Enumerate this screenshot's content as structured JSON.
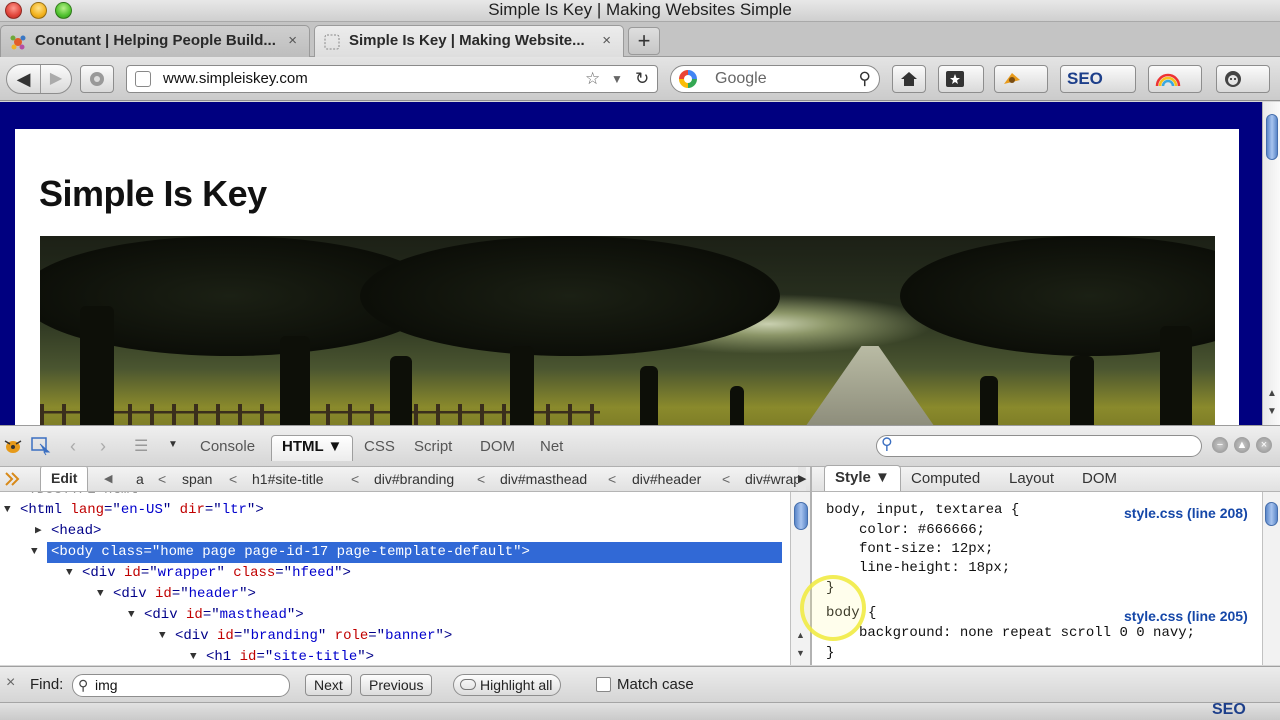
{
  "window": {
    "title": "Simple Is Key | Making Websites Simple"
  },
  "tabs": [
    {
      "label": "Conutant | Helping People Build...",
      "close": "×"
    },
    {
      "label": "Simple Is Key | Making Website...",
      "close": "×"
    }
  ],
  "new_tab_label": "+",
  "nav": {
    "back": "◀",
    "forward": "▶",
    "url": "www.simpleiskey.com",
    "bookmark_star": "☆",
    "dropdown": "▼",
    "reload": "↻",
    "search_placeholder": "Google",
    "search_icon": "⚲",
    "seo_label": "SEO"
  },
  "page": {
    "site_title": "Simple Is Key"
  },
  "firebug": {
    "tabs": [
      "Console",
      "HTML ▼",
      "CSS",
      "Script",
      "DOM",
      "Net"
    ],
    "active_tab_index": 1,
    "edit_label": "Edit",
    "breadcrumbs": [
      "a",
      "span",
      "h1#site-title",
      "div#branding",
      "div#masthead",
      "div#header",
      "div#wrap"
    ],
    "crumb_sep": "<",
    "side_tabs": [
      "Style ▼",
      "Computed",
      "Layout",
      "DOM"
    ],
    "html_tree": [
      {
        "text_tag": "<html",
        "attrs": [
          [
            "lang",
            "en-US"
          ],
          [
            "dir",
            "ltr"
          ]
        ],
        "end": ">",
        "indent": 0,
        "twisty": "▼"
      },
      {
        "text_tag": "<head",
        "attrs": [],
        "end": ">",
        "indent": 1,
        "twisty": "▶"
      },
      {
        "text_tag": "<body",
        "attrs": [
          [
            "class",
            "home page page-id-17 page-template-default"
          ]
        ],
        "end": ">",
        "indent": 1,
        "twisty": "▼",
        "selected": true
      },
      {
        "text_tag": "<div",
        "attrs": [
          [
            "id",
            "wrapper"
          ],
          [
            "class",
            "hfeed"
          ]
        ],
        "end": ">",
        "indent": 2,
        "twisty": "▼"
      },
      {
        "text_tag": "<div",
        "attrs": [
          [
            "id",
            "header"
          ]
        ],
        "end": ">",
        "indent": 3,
        "twisty": "▼"
      },
      {
        "text_tag": "<div",
        "attrs": [
          [
            "id",
            "masthead"
          ]
        ],
        "end": ">",
        "indent": 4,
        "twisty": "▼"
      },
      {
        "text_tag": "<div",
        "attrs": [
          [
            "id",
            "branding"
          ],
          [
            "role",
            "banner"
          ]
        ],
        "end": ">",
        "indent": 5,
        "twisty": "▼"
      },
      {
        "text_tag": "<h1",
        "attrs": [
          [
            "id",
            "site-title"
          ]
        ],
        "end": ">",
        "indent": 6,
        "twisty": "▼"
      }
    ],
    "doctype_partial": "<!DOCTYPE html>",
    "css_rules": [
      {
        "selector": "body, input, textarea {",
        "source": "style.css (line 208)",
        "props": [
          "color: #666666;",
          "font-size: 12px;",
          "line-height: 18px;"
        ],
        "close": "}"
      },
      {
        "selector": "body {",
        "source": "style.css (line 205)",
        "props": [
          "background: none repeat scroll 0 0 navy;"
        ],
        "close": "}"
      }
    ]
  },
  "findbar": {
    "close": "×",
    "label": "Find:",
    "query": "img",
    "next": "Next",
    "previous": "Previous",
    "highlight_all": "Highlight all",
    "match_case": "Match case"
  },
  "status": {
    "seo_badge": "SEO"
  },
  "colors": {
    "navy": "#000080",
    "selection": "#3169d6",
    "link": "#1547a8"
  }
}
